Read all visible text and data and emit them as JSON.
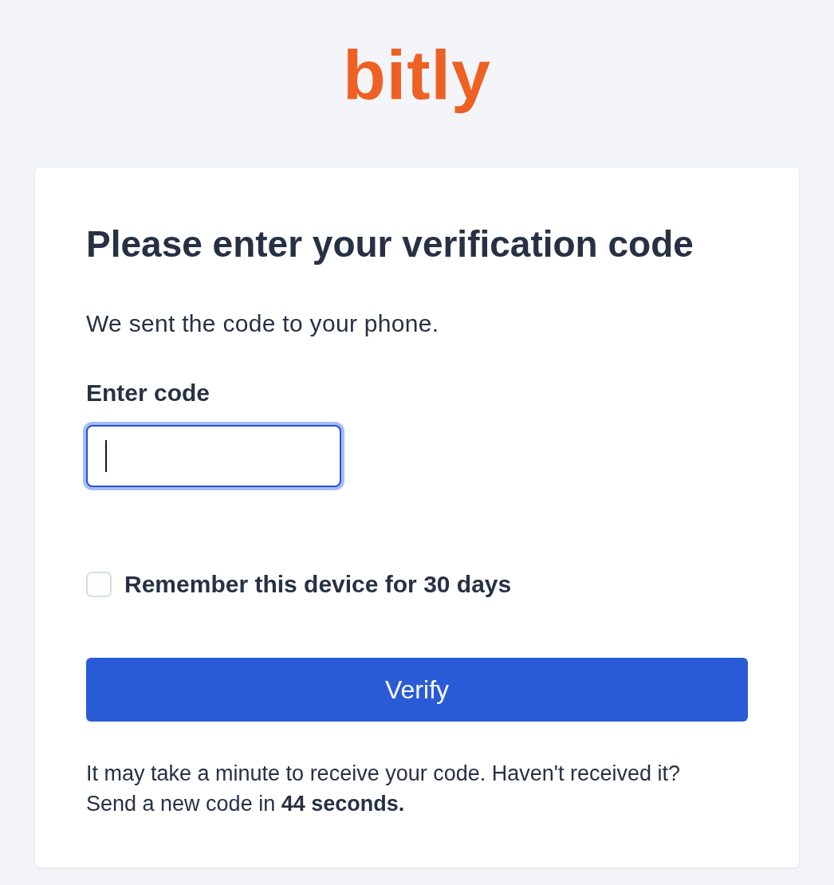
{
  "logo": {
    "text": "bitly"
  },
  "card": {
    "title": "Please enter your verification code",
    "subtitle": "We sent the code to your phone.",
    "code_field": {
      "label": "Enter code",
      "focused": true
    },
    "remember": {
      "label": "Remember this device for 30 days",
      "checked": false
    },
    "button": {
      "label": "Verify"
    },
    "footer": {
      "lines": [
        "It may take a minute to receive your code. Haven't received it?",
        "Send a new code in **44 seconds.**"
      ]
    }
  }
}
